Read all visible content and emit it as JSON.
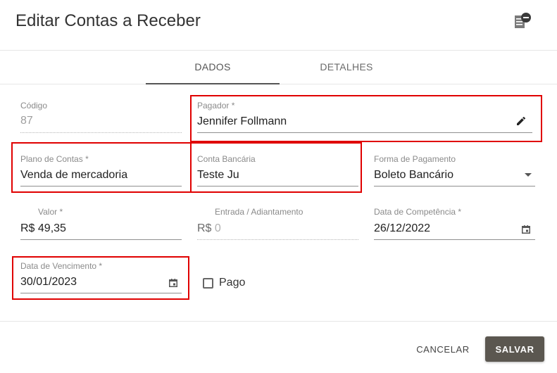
{
  "dialog": {
    "title": "Editar Contas a Receber",
    "header_icon": "receipt-remove-icon"
  },
  "tabs": [
    {
      "label": "DADOS",
      "active": true
    },
    {
      "label": "DETALHES",
      "active": false
    }
  ],
  "form": {
    "codigo": {
      "label": "Código",
      "value": "87"
    },
    "pagador": {
      "label": "Pagador *",
      "value": "Jennifer Follmann"
    },
    "plano_contas": {
      "label": "Plano de Contas *",
      "value": "Venda de mercadoria"
    },
    "conta_bancaria": {
      "label": "Conta Bancária",
      "value": "Teste Ju"
    },
    "forma_pagamento": {
      "label": "Forma de Pagamento",
      "value": "Boleto Bancário"
    },
    "valor": {
      "label": "Valor *",
      "prefix": "R$",
      "value": "49,35"
    },
    "entrada": {
      "label": "Entrada / Adiantamento",
      "prefix": "R$",
      "value": "0"
    },
    "data_competencia": {
      "label": "Data de Competência *",
      "value": "26/12/2022"
    },
    "data_vencimento": {
      "label": "Data de Vencimento *",
      "value": "30/01/2023"
    },
    "pago": {
      "label": "Pago",
      "checked": false
    }
  },
  "footer": {
    "cancel_label": "CANCELAR",
    "save_label": "SALVAR"
  },
  "colors": {
    "highlight": "#e00000",
    "primary_button": "#5b5750"
  }
}
